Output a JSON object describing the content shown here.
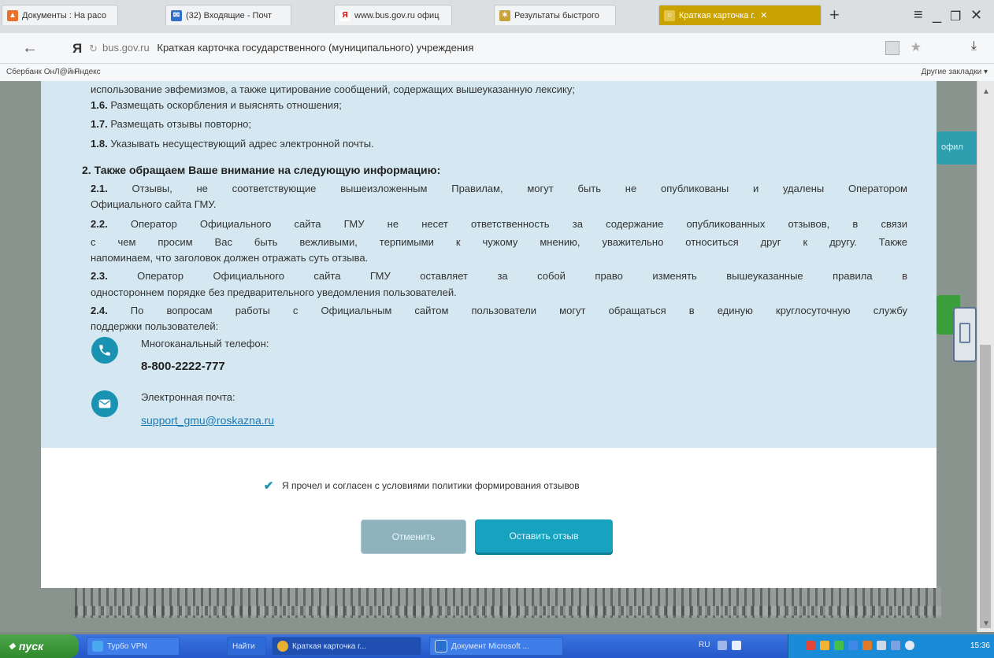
{
  "browser": {
    "tabs": [
      {
        "label": "Документы : На расо"
      },
      {
        "label": "(32) Входящие - Почт"
      },
      {
        "label": "www.bus.gov.ru офиц"
      },
      {
        "label": "Результаты быстрого"
      },
      {
        "label": "Краткая карточка г."
      }
    ],
    "url_domain": "bus.gov.ru",
    "url_title": "Краткая карточка государственного (муниципального) учреждения",
    "bookmarks": [
      "Сбербанк ОнЛ@йн",
      "Яндекс"
    ],
    "other_bookmarks": "Другие закладки ▾"
  },
  "page": {
    "side_button_text": "офил"
  },
  "rules": {
    "line_intro": "использование эвфемизмов, а также цитирование сообщений, содержащих вышеуказанную лексику;",
    "items": [
      {
        "num": "1.6.",
        "text": "Размещать оскорбления и выяснять отношения;"
      },
      {
        "num": "1.7.",
        "text": "Размещать отзывы повторно;"
      },
      {
        "num": "1.8.",
        "text": "Указывать несуществующий адрес электронной почты."
      }
    ],
    "section2_heading": "2. Также обращаем Ваше внимание на следующую информацию:",
    "section2": [
      {
        "num": "2.1.",
        "lines": [
          "Отзывы, не соответствующие вышеизложенным Правилам, могут быть не опубликованы и удалены Оператором",
          "Официального сайта ГМУ."
        ]
      },
      {
        "num": "2.2.",
        "lines": [
          "Оператор Официального сайта ГМУ не несет ответственность за содержание опубликованных отзывов, в связи",
          "с чем просим Вас быть вежливыми, терпимыми к чужому мнению, уважительно относиться друг к другу. Также",
          "напоминаем, что заголовок должен отражать суть отзыва."
        ]
      },
      {
        "num": "2.3.",
        "lines": [
          "Оператор Официального сайта ГМУ оставляет за собой право изменять вышеуказанные правила в",
          "одностороннем порядке без предварительного уведомления пользователей."
        ]
      },
      {
        "num": "2.4.",
        "lines": [
          "По вопросам работы с Официальным сайтом пользователи могут обращаться в единую круглосуточную службу",
          "поддержки пользователей:"
        ]
      }
    ],
    "phone_label": "Многоканальный телефон:",
    "phone": "8-800-2222-777",
    "email_label": "Электронная почта:",
    "email": "support_gmu@roskazna.ru"
  },
  "form": {
    "agree_label": "Я прочел и согласен с условиями политики формирования отзывов",
    "agree_checked": true,
    "cancel_label": "Отменить",
    "submit_label": "Оставить отзыв"
  },
  "taskbar": {
    "start_label": "пуск",
    "items": [
      "Турбо VPN",
      "Найти",
      "Краткая карточка г...",
      "Документ Microsoft ..."
    ],
    "lang": "RU",
    "clock": "15:36"
  }
}
